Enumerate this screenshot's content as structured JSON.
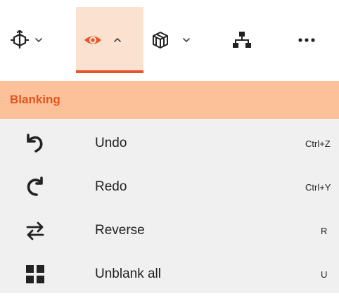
{
  "toolbar": {
    "icons": [
      "orientation-cube-icon",
      "eye-icon",
      "wireframe-box-icon",
      "hierarchy-icon",
      "more-icon"
    ],
    "accent_color": "#e8542a",
    "active_bg": "#fbe1cf"
  },
  "menu": {
    "title": "Blanking",
    "header_bg": "#fdc19a",
    "items": [
      {
        "label": "Undo",
        "shortcut": "Ctrl+Z",
        "icon": "undo-icon"
      },
      {
        "label": "Redo",
        "shortcut": "Ctrl+Y",
        "icon": "redo-icon"
      },
      {
        "label": "Reverse",
        "shortcut": "R",
        "icon": "swap-arrows-icon"
      },
      {
        "label": "Unblank all",
        "shortcut": "U",
        "icon": "grid-four-icon"
      }
    ]
  }
}
